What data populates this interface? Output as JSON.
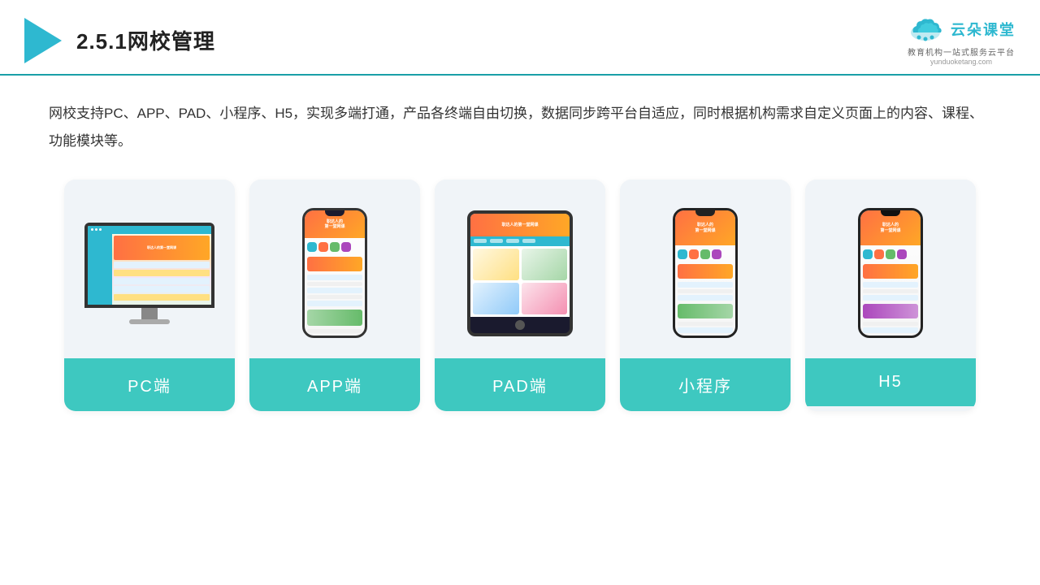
{
  "header": {
    "title": "2.5.1网校管理",
    "brand_name": "云朵课堂",
    "brand_domain": "yunduoketang.com",
    "brand_tagline": "教育机构一站\n式服务云平台"
  },
  "description": "网校支持PC、APP、PAD、小程序、H5，实现多端打通，产品各终端自由切换，数据同步跨平台自适应，同时根据机构需求自定义页面上的内容、课程、功能模块等。",
  "cards": [
    {
      "id": "pc",
      "label": "PC端"
    },
    {
      "id": "app",
      "label": "APP端"
    },
    {
      "id": "pad",
      "label": "PAD端"
    },
    {
      "id": "miniprogram",
      "label": "小程序"
    },
    {
      "id": "h5",
      "label": "H5"
    }
  ],
  "accent_color": "#3ec8c0",
  "accent_dark": "#2eb8d0"
}
